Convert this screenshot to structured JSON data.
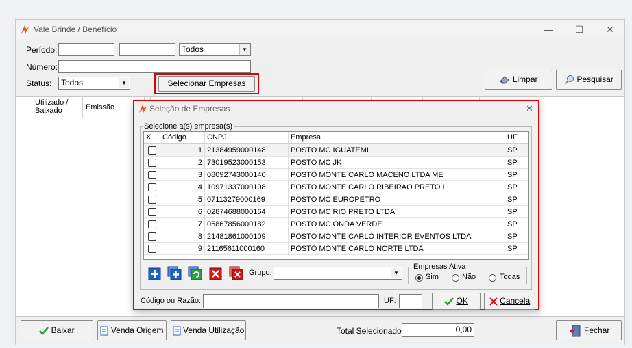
{
  "window": {
    "title": "Vale Brinde / Benefício",
    "minimize": "—",
    "maximize": "☐",
    "close": "✕"
  },
  "filters": {
    "periodo_label": "Período:",
    "periodo_start": "",
    "periodo_end": "",
    "periodo_select": "Todos",
    "numero_label": "Número:",
    "numero_value": "",
    "status_label": "Status:",
    "status_select": "Todos",
    "select_companies_button": "Selecionar Empresas",
    "clear_button": "Limpar",
    "search_button": "Pesquisar"
  },
  "grid": {
    "columns": [
      "Utilizado / Baixado",
      "Emissão"
    ]
  },
  "bottom": {
    "baixar_button": "Baixar",
    "venda_origem_button": "Venda Origem",
    "venda_utilizacao_button": "Venda Utilização",
    "total_label": "Total Selecionado:",
    "total_value": "0,00",
    "fechar_button": "Fechar"
  },
  "dialog": {
    "title": "Seleção de Empresas",
    "close": "✕",
    "group_title": "Selecione a(s) empresa(s)",
    "columns": {
      "x": "X",
      "codigo": "Código",
      "cnpj": "CNPJ",
      "empresa": "Empresa",
      "uf": "UF"
    },
    "rows": [
      {
        "codigo": "1",
        "cnpj": "21384959000148",
        "empresa": "POSTO MC IGUATEMI",
        "uf": "SP"
      },
      {
        "codigo": "2",
        "cnpj": "73019523000153",
        "empresa": "POSTO MC JK",
        "uf": "SP"
      },
      {
        "codigo": "3",
        "cnpj": "08092743000140",
        "empresa": "POSTO MONTE CARLO MACENO LTDA ME",
        "uf": "SP"
      },
      {
        "codigo": "4",
        "cnpj": "10971337000108",
        "empresa": "POSTO MONTE CARLO RIBEIRAO PRETO I",
        "uf": "SP"
      },
      {
        "codigo": "5",
        "cnpj": "07113279000169",
        "empresa": "POSTO MC EUROPETRO",
        "uf": "SP"
      },
      {
        "codigo": "6",
        "cnpj": "02874688000164",
        "empresa": "POSTO MC RIO PRETO LTDA",
        "uf": "SP"
      },
      {
        "codigo": "7",
        "cnpj": "05867856000182",
        "empresa": "POSTO MC ONDA VERDE",
        "uf": "SP"
      },
      {
        "codigo": "8",
        "cnpj": "21481861000109",
        "empresa": "POSTO MONTE CARLO INTERIOR EVENTOS LTDA",
        "uf": "SP"
      },
      {
        "codigo": "9",
        "cnpj": "21165611000160",
        "empresa": "POSTO MONTE CARLO NORTE LTDA",
        "uf": "SP"
      }
    ],
    "grupo_label": "Grupo:",
    "grupo_value": "",
    "ativa_title": "Empresas Ativa",
    "ativa_options": [
      "Sim",
      "Não",
      "Todas"
    ],
    "ativa_selected": "Sim",
    "codigo_razao_label": "Código ou Razão:",
    "codigo_razao_value": "",
    "uf_label": "UF:",
    "uf_value": "",
    "ok_button": "OK",
    "cancel_button": "Cancela"
  },
  "colors": {
    "highlight_red": "#e00000",
    "ok_green": "#2e9e2e",
    "cancel_red": "#d01818",
    "icon_blue": "#1f63c9"
  }
}
